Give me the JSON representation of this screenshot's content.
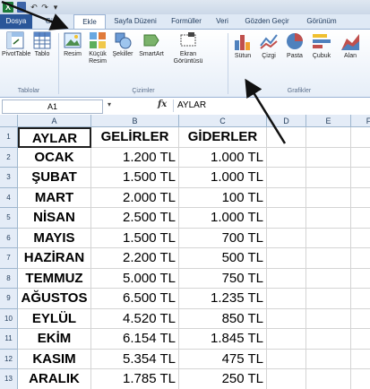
{
  "quick_access": {
    "logo": "X"
  },
  "tabs": [
    "Dosya",
    "Giriş",
    "Ekle",
    "Sayfa Düzeni",
    "Formüller",
    "Veri",
    "Gözden Geçir",
    "Görünüm"
  ],
  "ribbon": {
    "groups": [
      "Tablolar",
      "Çizimler",
      "Grafikler"
    ],
    "buttons": {
      "pivottable": "PivotTable",
      "tablo": "Tablo",
      "resim": "Resim",
      "kucuk_resim_1": "Küçük",
      "kucuk_resim_2": "Resim",
      "sekiller": "Şekiller",
      "smartart": "SmartArt",
      "ekran_1": "Ekran",
      "ekran_2": "Görüntüsü",
      "sutun": "Sütun",
      "cizgi": "Çizgi",
      "pasta": "Pasta",
      "cubuk": "Çubuk",
      "alan": "Alan"
    }
  },
  "formula_bar": {
    "name_box": "A1",
    "fx": "fx",
    "value": "AYLAR"
  },
  "columns": [
    "A",
    "B",
    "C",
    "D",
    "E",
    "F"
  ],
  "rows": [
    "1",
    "2",
    "3",
    "4",
    "5",
    "6",
    "7",
    "8",
    "9",
    "10",
    "11",
    "12",
    "13"
  ],
  "table": {
    "headers": [
      "AYLAR",
      "GELİRLER",
      "GİDERLER"
    ],
    "rows": [
      [
        "OCAK",
        "1.200 TL",
        "1.000 TL"
      ],
      [
        "ŞUBAT",
        "1.500 TL",
        "1.000 TL"
      ],
      [
        "MART",
        "2.000 TL",
        "100 TL"
      ],
      [
        "NİSAN",
        "2.500 TL",
        "1.000 TL"
      ],
      [
        "MAYIS",
        "1.500 TL",
        "700 TL"
      ],
      [
        "HAZİRAN",
        "2.200 TL",
        "500 TL"
      ],
      [
        "TEMMUZ",
        "5.000 TL",
        "750 TL"
      ],
      [
        "AĞUSTOS",
        "6.500 TL",
        "1.235 TL"
      ],
      [
        "EYLÜL",
        "4.520 TL",
        "850 TL"
      ],
      [
        "EKİM",
        "6.154 TL",
        "1.845 TL"
      ],
      [
        "KASIM",
        "5.354 TL",
        "475 TL"
      ],
      [
        "ARALIK",
        "1.785 TL",
        "250 TL"
      ]
    ]
  }
}
